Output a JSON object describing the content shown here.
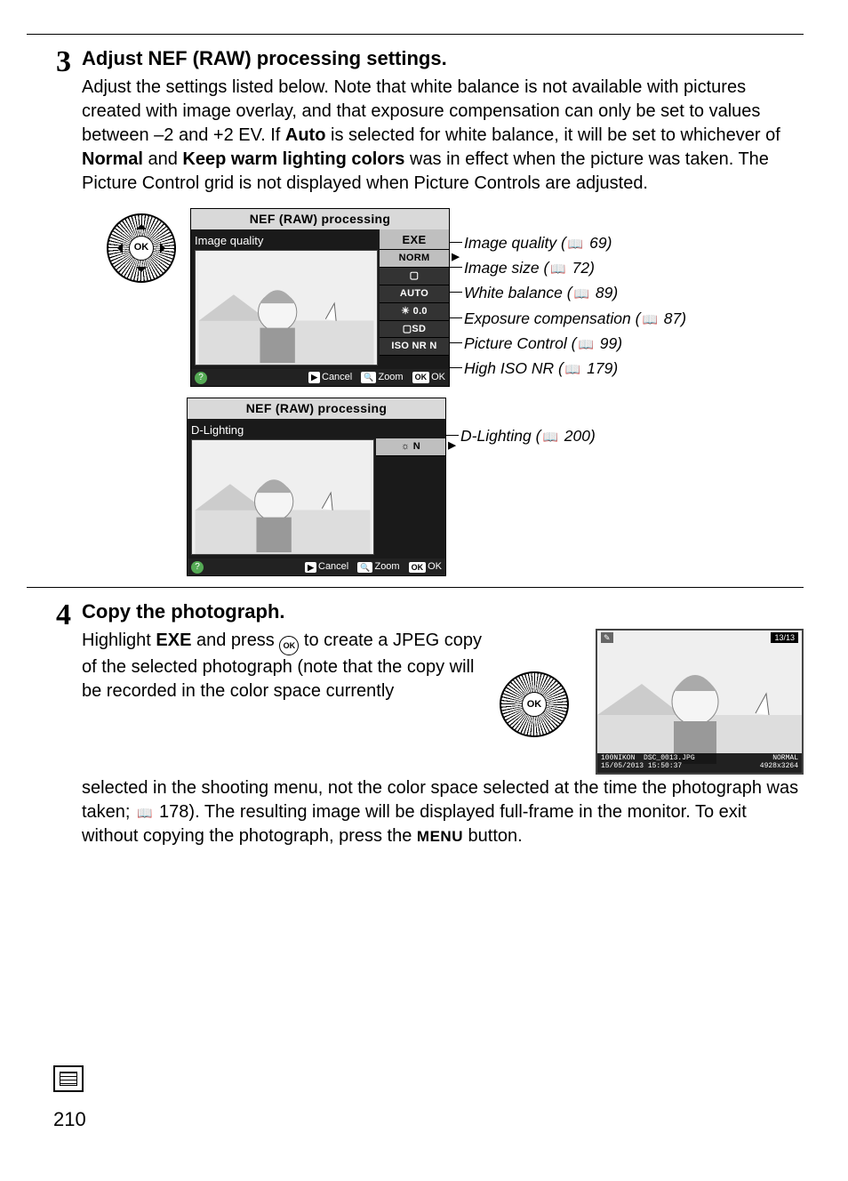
{
  "page_number": "210",
  "step3": {
    "num": "3",
    "title": "Adjust NEF (RAW) processing settings.",
    "p1a": "Adjust the settings listed below.  Note that white balance is not available with pictures created with image overlay, and that exposure compensation can only be set to values between –2 and +2 EV.  If ",
    "auto": "Auto",
    "p1b": " is selected for white balance, it will be set to whichever of ",
    "normal": "Normal",
    "p1c": " and ",
    "keepwarm": "Keep warm lighting colors",
    "p1d": " was in effect when the picture was taken.  The Picture Control grid is not displayed when Picture Controls are adjusted."
  },
  "screen1": {
    "title": "NEF (RAW) processing",
    "label": "Image quality",
    "opts": {
      "exe": "EXE",
      "norm": "NORM",
      "size": "▢",
      "wb": "AUTO",
      "ev": "☀ 0.0",
      "pc": "▢SD",
      "iso": "ISO NR N"
    },
    "footer": {
      "cancel": "Cancel",
      "zoom": "Zoom",
      "ok": "OK"
    }
  },
  "callouts1": [
    {
      "label": "Image quality",
      "page": "69"
    },
    {
      "label": "Image size",
      "page": "72"
    },
    {
      "label": "White balance",
      "page": "89"
    },
    {
      "label": "Exposure compensation",
      "page": "87"
    },
    {
      "label": "Picture Control",
      "page": "99"
    },
    {
      "label": "High ISO NR",
      "page": "179"
    }
  ],
  "screen2": {
    "title": "NEF (RAW) processing",
    "label": "D-Lighting",
    "opt": "☼ N",
    "footer": {
      "cancel": "Cancel",
      "zoom": "Zoom",
      "ok": "OK"
    }
  },
  "callouts2": [
    {
      "label": "D-Lighting",
      "page": "200"
    }
  ],
  "step4": {
    "num": "4",
    "title": "Copy the photograph.",
    "p1a": "Highlight ",
    "exe": "EXE",
    "p1b": " and press ",
    "p1c": " to create a JPEG copy of the selected photograph (note that the copy will be recorded in the color space currently",
    "p2a": "selected in the shooting menu, not the color space selected at the time the photograph was taken; ",
    "p2page": "178",
    "p2b": ").  The resulting image will be displayed full-frame in the monitor.  To exit without copying the photograph, press the ",
    "menu": "MENU",
    "p2c": " button."
  },
  "result_meta": {
    "folder": "100NIKON",
    "file": "DSC_0013.JPG",
    "date": "15/05/2013",
    "time": "15:50:37",
    "quality": "NORMAL",
    "size": "4928x3264",
    "count": "13/13"
  }
}
